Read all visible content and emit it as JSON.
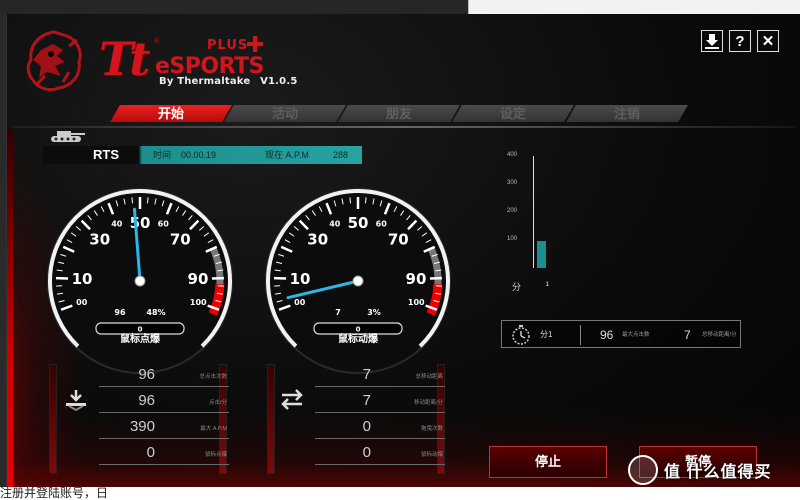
{
  "app": {
    "brand_tt": "Tt",
    "brand_esports": "eSPORTS",
    "brand_plus": "PLUS",
    "brand_by": "By Thermaltake",
    "version": "V1.0.5",
    "window_buttons": [
      {
        "name": "download-icon",
        "glyph": "⇩"
      },
      {
        "name": "help-icon",
        "glyph": "?"
      },
      {
        "name": "close-icon",
        "glyph": "✕"
      }
    ]
  },
  "tabs": [
    {
      "label": "开始",
      "active": true
    },
    {
      "label": "活动",
      "active": false
    },
    {
      "label": "朋友",
      "active": false
    },
    {
      "label": "设定",
      "active": false
    },
    {
      "label": "注销",
      "active": false
    }
  ],
  "game": {
    "mode": "RTS",
    "time_label": "时间",
    "time_value": "00.00.19",
    "apm_label": "现在 A.P.M",
    "apm_value": "288"
  },
  "gauge_click": {
    "title": "鼠标点爆",
    "ticks": [
      "00",
      "10",
      "30",
      "40",
      "50",
      "60",
      "70",
      "90",
      "100"
    ],
    "needle_value": 48,
    "count": "96",
    "percent": "48%",
    "readout": "0"
  },
  "gauge_move": {
    "title": "鼠标动爆",
    "ticks": [
      "00",
      "10",
      "30",
      "40",
      "50",
      "60",
      "70",
      "90",
      "100"
    ],
    "needle_value": 3,
    "count": "7",
    "percent": "3%",
    "readout": "0"
  },
  "click_stats": [
    {
      "value": "96",
      "label": "总点击次数"
    },
    {
      "value": "96",
      "label": "点击/分"
    },
    {
      "value": "390",
      "label": "最大 A.P.M"
    },
    {
      "value": "0",
      "label": "鼠标点爆"
    }
  ],
  "move_stats": [
    {
      "value": "7",
      "label": "总移动距离"
    },
    {
      "value": "7",
      "label": "移动距离/分"
    },
    {
      "value": "0",
      "label": "拖曳次数"
    },
    {
      "value": "0",
      "label": "鼠标动爆"
    }
  ],
  "chart_data": {
    "type": "bar",
    "categories": [
      "1"
    ],
    "values": [
      95
    ],
    "ylim": [
      0,
      400
    ],
    "yticks": [
      "400",
      "300",
      "200",
      "100"
    ],
    "x_unit_label": "分",
    "bar_color": "#1b8f8f"
  },
  "summary": {
    "minute_label": "分1",
    "max_clicks_value": "96",
    "max_clicks_label": "最大点击数",
    "max_move_value": "7",
    "max_move_label": "总移动距离/分"
  },
  "buttons": {
    "stop": "停止",
    "pause": "暂停"
  },
  "watermark": "值 什么值得买",
  "bottom_text": "注册并登陆账号，日"
}
